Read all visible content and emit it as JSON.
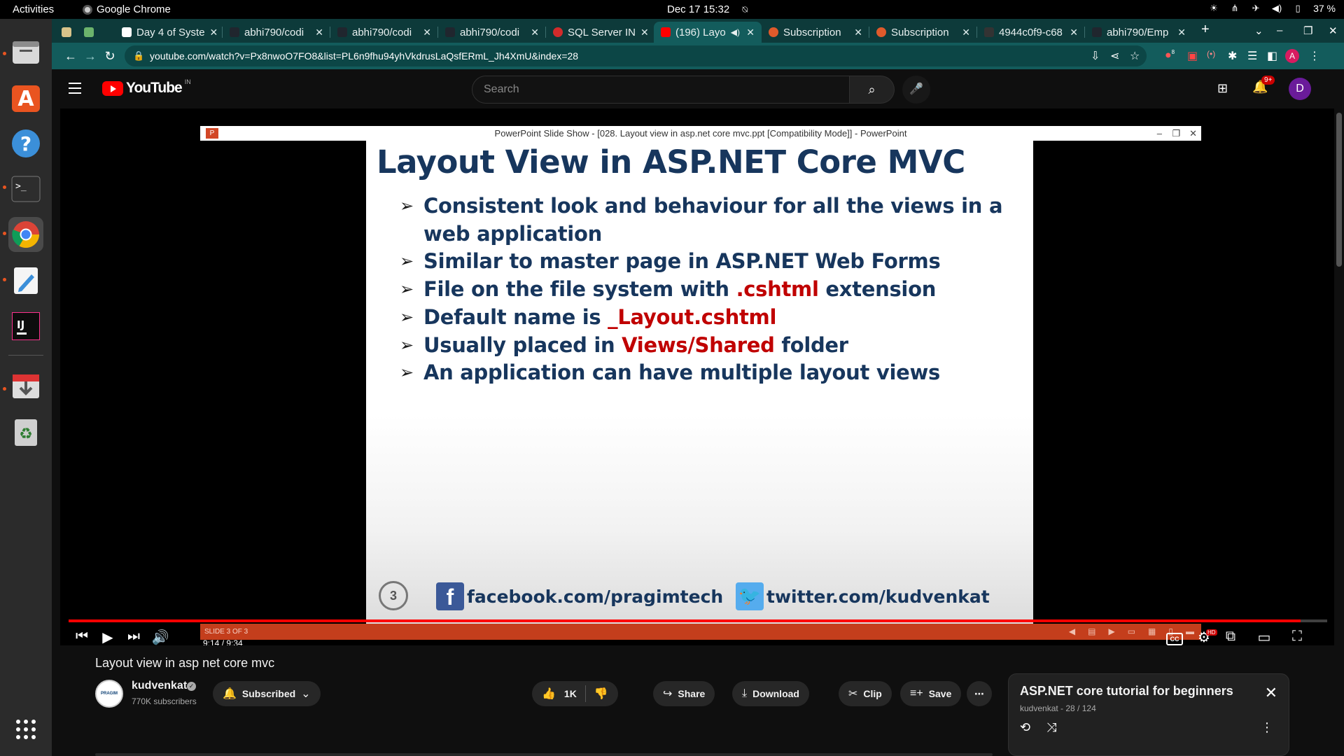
{
  "topbar": {
    "activities": "Activities",
    "app_name": "Google Chrome",
    "clock": "Dec 17  15:32",
    "battery": "37 %"
  },
  "dock": {
    "items": [
      {
        "name": "files",
        "icon": "folder-icon"
      },
      {
        "name": "software",
        "icon": "app-store-icon"
      },
      {
        "name": "help",
        "icon": "help-icon"
      },
      {
        "name": "terminal",
        "icon": "terminal-icon"
      },
      {
        "name": "chrome",
        "icon": "chrome-icon"
      },
      {
        "name": "text-editor",
        "icon": "text-editor-icon"
      },
      {
        "name": "intellij",
        "icon": "intellij-icon",
        "label": "IJ"
      },
      {
        "name": "installer",
        "icon": "download-icon"
      },
      {
        "name": "trash",
        "icon": "trash-icon"
      }
    ],
    "accent": "#e95420"
  },
  "tabs": [
    {
      "label": "",
      "favicon": "#d8c38a"
    },
    {
      "label": "",
      "favicon": "#6cb36c"
    },
    {
      "label": "Day 4 of Syste",
      "favicon": "#ffffff"
    },
    {
      "label": "abhi790/codi",
      "favicon": "#20262e"
    },
    {
      "label": "abhi790/codi",
      "favicon": "#20262e"
    },
    {
      "label": "abhi790/codi",
      "favicon": "#20262e"
    },
    {
      "label": "SQL Server IN",
      "favicon": "#d22b2b"
    },
    {
      "label": "(196) Layo",
      "favicon": "#ff0000"
    },
    {
      "label": "Subscription",
      "favicon": "#e05a2b"
    },
    {
      "label": "Subscription",
      "favicon": "#e05a2b"
    },
    {
      "label": "4944c0f9-c68",
      "favicon": "#333333"
    },
    {
      "label": "abhi790/Emp",
      "favicon": "#20262e"
    }
  ],
  "toolbar": {
    "url": "youtube.com/watch?v=Px8nwoO7FO8&list=PL6n9fhu94yhVkdrusLaQsfERmL_Jh4XmU&index=28",
    "ext_badge": "8",
    "profile_initial": "A"
  },
  "youtube": {
    "logo_text": "YouTube",
    "region": "IN",
    "search_placeholder": "Search",
    "notif_count": "9+",
    "avatar_initial": "D"
  },
  "player": {
    "ppt_title": "PowerPoint Slide Show - [028. Layout view in asp.net core mvc.ppt [Compatibility Mode]] - PowerPoint",
    "slide": {
      "title": "Layout View in ASP.NET Core MVC",
      "bullets": [
        {
          "pre": "Consistent look and behaviour for all the views in a web application",
          "hl": "",
          "post": ""
        },
        {
          "pre": "Similar to master page in ASP.NET Web Forms",
          "hl": "",
          "post": ""
        },
        {
          "pre": "File on the file system with ",
          "hl": ".cshtml",
          "post": " extension"
        },
        {
          "pre": "Default name is ",
          "hl": "_Layout.cshtml",
          "post": ""
        },
        {
          "pre": "Usually placed in ",
          "hl": "Views/Shared",
          "post": " folder"
        },
        {
          "pre": "An application can have multiple layout views",
          "hl": "",
          "post": ""
        }
      ],
      "number": "3",
      "facebook": "facebook.com/pragimtech",
      "twitter": "twitter.com/kudvenkat",
      "status": "SLIDE 3 OF 3"
    },
    "time": "9:14 / 9:34",
    "progress": 0.9786,
    "hd": "HD",
    "cc": "CC"
  },
  "video": {
    "title": "Layout view in asp net core mvc",
    "channel": "kudvenkat",
    "channel_logo": "PRAGIM",
    "subscribers": "770K subscribers",
    "subscribed_label": "Subscribed",
    "likes": "1K",
    "share_label": "Share",
    "download_label": "Download",
    "clip_label": "Clip",
    "save_label": "Save"
  },
  "playlist": {
    "title": "ASP.NET core tutorial for beginners",
    "subtitle": "kudvenkat - 28 / 124"
  }
}
